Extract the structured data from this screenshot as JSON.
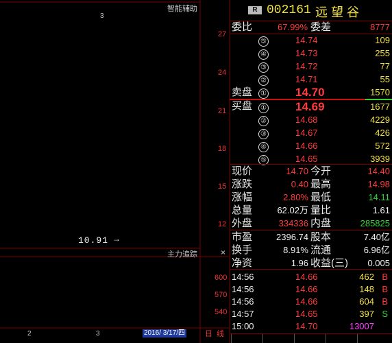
{
  "chart": {
    "aux_title": "智能辅助",
    "main_close": "×",
    "indicator_title": "主力追踪",
    "indicator_close": "×",
    "low_marker": "10.91",
    "low_arrow": "→",
    "date_label": "2016/ 3/17/四",
    "period_tab": "日",
    "period_tab2": "线",
    "x_labels": [
      "2",
      "3"
    ],
    "top_x_label": "3",
    "price_axis": [
      "27",
      "24",
      "21",
      "18",
      "15",
      "12"
    ],
    "volume_axis": [
      "600",
      "570",
      "540"
    ]
  },
  "header": {
    "badge": "R",
    "code": "002161",
    "name": "远 望 谷"
  },
  "ratio": {
    "label1": "委比",
    "value1": "67.99%",
    "label2": "委差",
    "value2": "8777"
  },
  "sell_label": "卖盘",
  "buy_label": "买盘",
  "asks": [
    {
      "level": "⑤",
      "price": "14.74",
      "vol": "109"
    },
    {
      "level": "④",
      "price": "14.73",
      "vol": "255"
    },
    {
      "level": "③",
      "price": "14.72",
      "vol": "77"
    },
    {
      "level": "②",
      "price": "14.71",
      "vol": "55"
    },
    {
      "level": "①",
      "price": "14.70",
      "vol": "1570"
    }
  ],
  "bids": [
    {
      "level": "①",
      "price": "14.69",
      "vol": "1677"
    },
    {
      "level": "②",
      "price": "14.68",
      "vol": "4229"
    },
    {
      "level": "③",
      "price": "14.67",
      "vol": "426"
    },
    {
      "level": "④",
      "price": "14.66",
      "vol": "572"
    },
    {
      "level": "⑤",
      "price": "14.65",
      "vol": "3939"
    }
  ],
  "stats": [
    {
      "l1": "现价",
      "v1": "14.70",
      "c1": "red",
      "l2": "今开",
      "v2": "14.40",
      "c2": "red"
    },
    {
      "l1": "涨跌",
      "v1": "0.40",
      "c1": "red",
      "l2": "最高",
      "v2": "14.98",
      "c2": "red"
    },
    {
      "l1": "涨幅",
      "v1": "2.80%",
      "c1": "red",
      "l2": "最低",
      "v2": "14.11",
      "c2": "green"
    },
    {
      "l1": "总量",
      "v1": "62.02万",
      "c1": "white",
      "l2": "量比",
      "v2": "1.61",
      "c2": "white"
    },
    {
      "l1": "外盘",
      "v1": "334336",
      "c1": "red",
      "l2": "内盘",
      "v2": "285825",
      "c2": "green"
    }
  ],
  "stats2": [
    {
      "l1": "市盈",
      "v1": "2396.74",
      "l2": "股本",
      "v2": "7.40亿"
    },
    {
      "l1": "换手",
      "v1": "8.91%",
      "l2": "流通",
      "v2": "6.96亿"
    },
    {
      "l1": "净资",
      "v1": "1.96",
      "l2": "收益(三)",
      "v2": "0.005"
    }
  ],
  "ticks": [
    {
      "time": "14:56",
      "price": "14.66",
      "vol": "462",
      "side": "B",
      "side_color": "red"
    },
    {
      "time": "14:56",
      "price": "14.66",
      "vol": "148",
      "side": "B",
      "side_color": "red"
    },
    {
      "time": "14:56",
      "price": "14.66",
      "vol": "604",
      "side": "B",
      "side_color": "red"
    },
    {
      "time": "14:57",
      "price": "14.65",
      "vol": "397",
      "side": "S",
      "side_color": "green"
    },
    {
      "time": "15:00",
      "price": "14.70",
      "vol": "13007",
      "side": "",
      "side_color": "magenta"
    }
  ],
  "bottom_tabs": [
    "",
    "",
    "",
    "",
    ""
  ],
  "colors": {
    "up": "#ff3b3b",
    "down": "#35e0ff",
    "grid": "#7a0000",
    "arrow": "#ffe000"
  }
}
